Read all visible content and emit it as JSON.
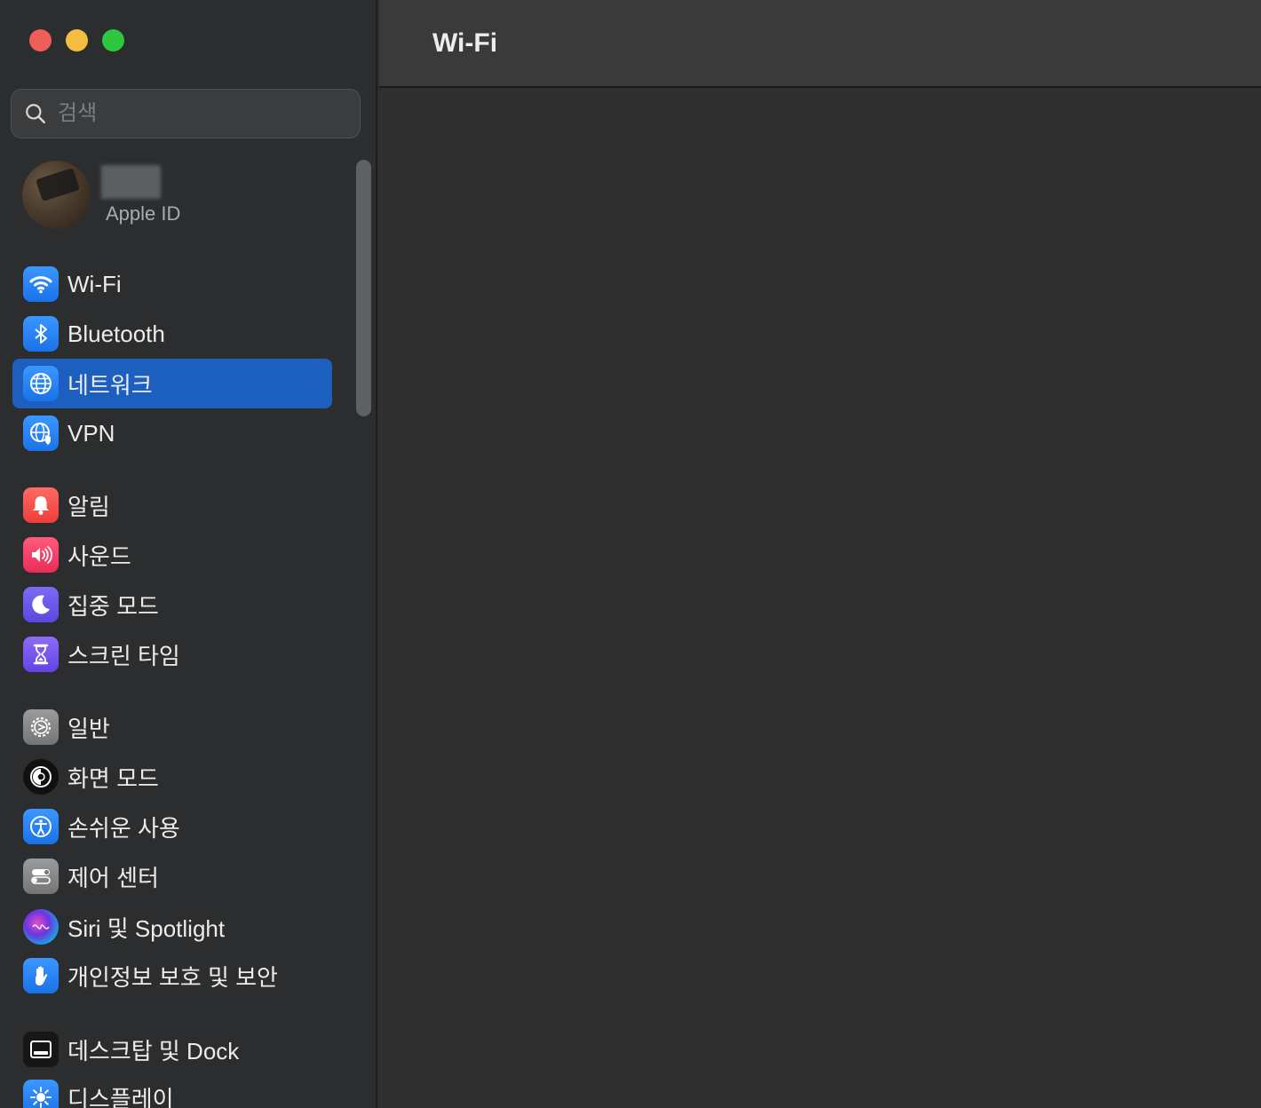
{
  "window": {
    "traffic_lights": [
      "close",
      "minimize",
      "maximize"
    ]
  },
  "search": {
    "placeholder": "검색",
    "icon": "search-icon"
  },
  "profile": {
    "subtitle": "Apple ID"
  },
  "sidebar": {
    "items": [
      {
        "label": "Wi-Fi",
        "icon": "wifi-icon",
        "selected": false
      },
      {
        "label": "Bluetooth",
        "icon": "bluetooth-icon",
        "selected": false
      },
      {
        "label": "네트워크",
        "icon": "globe-icon",
        "selected": true
      },
      {
        "label": "VPN",
        "icon": "vpn-globe-icon",
        "selected": false
      },
      {
        "label": "알림",
        "icon": "bell-icon",
        "selected": false
      },
      {
        "label": "사운드",
        "icon": "speaker-icon",
        "selected": false
      },
      {
        "label": "집중 모드",
        "icon": "moon-icon",
        "selected": false
      },
      {
        "label": "스크린 타임",
        "icon": "hourglass-icon",
        "selected": false
      },
      {
        "label": "일반",
        "icon": "gear-icon",
        "selected": false
      },
      {
        "label": "화면 모드",
        "icon": "appearance-icon",
        "selected": false
      },
      {
        "label": "손쉬운 사용",
        "icon": "accessibility-icon",
        "selected": false
      },
      {
        "label": "제어 센터",
        "icon": "toggles-icon",
        "selected": false
      },
      {
        "label": "Siri 및 Spotlight",
        "icon": "siri-icon",
        "selected": false
      },
      {
        "label": "개인정보 보호 및 보안",
        "icon": "hand-icon",
        "selected": false
      },
      {
        "label": "데스크탑 및 Dock",
        "icon": "dock-icon",
        "selected": false
      },
      {
        "label": "디스플레이",
        "icon": "sun-icon",
        "selected": false
      }
    ]
  },
  "main": {
    "title": "Wi-Fi"
  },
  "colors": {
    "selection": "#1c5fbf",
    "sidebar_bg": "#2b2d2f",
    "content_bg": "#303030"
  }
}
